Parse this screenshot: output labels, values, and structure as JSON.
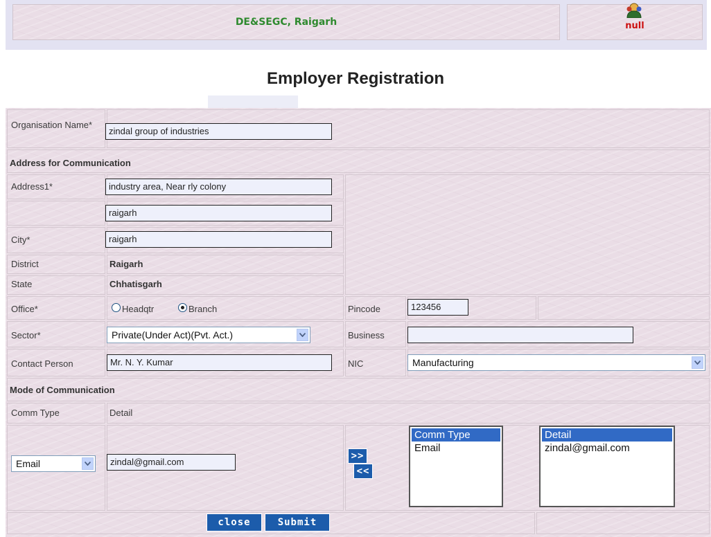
{
  "header": {
    "title": "DE&SEGC, Raigarh",
    "user": "null",
    "user_icon": "user-icon"
  },
  "page_title": "Employer Registration",
  "form": {
    "organisation_label": "Organisation Name*",
    "organisation_value": "zindal group of industries",
    "address_section": "Address for Communication",
    "address1_label": "Address1*",
    "address1_value": "industry area, Near rly colony",
    "address2_value": "raigarh",
    "city_label": "City*",
    "city_value": "raigarh",
    "district_label": "District",
    "district_value": "Raigarh",
    "state_label": "State",
    "state_value": "Chhatisgarh",
    "office_label": "Office*",
    "office_options": [
      "Headqtr",
      "Branch"
    ],
    "office_selected": "Branch",
    "pincode_label": "Pincode",
    "pincode_value": "123456",
    "sector_label": "Sector*",
    "sector_value": "Private(Under Act)(Pvt. Act.)",
    "business_label": "Business",
    "business_value": "",
    "contact_label": "Contact Person",
    "contact_value": "Mr. N. Y. Kumar",
    "nic_label": "NIC",
    "nic_value": "Manufacturing",
    "mode_section": "Mode of Communication",
    "comm_type_header": "Comm Type",
    "detail_header": "Detail",
    "comm_type_value": "Email",
    "detail_value": "zindal@gmail.com",
    "add_button": ">>",
    "remove_button": "<<",
    "comm_type_list": [
      "Comm Type",
      "Email"
    ],
    "detail_list": [
      "Detail",
      "zindal@gmail.com"
    ]
  },
  "buttons": {
    "close": "close",
    "submit": "Submit"
  },
  "colors": {
    "header_title": "#2f8a2f",
    "user_text": "#cc1111",
    "button_blue": "#1c5cab",
    "panel_pink": "#eadde6",
    "list_selection": "#316ac5"
  }
}
